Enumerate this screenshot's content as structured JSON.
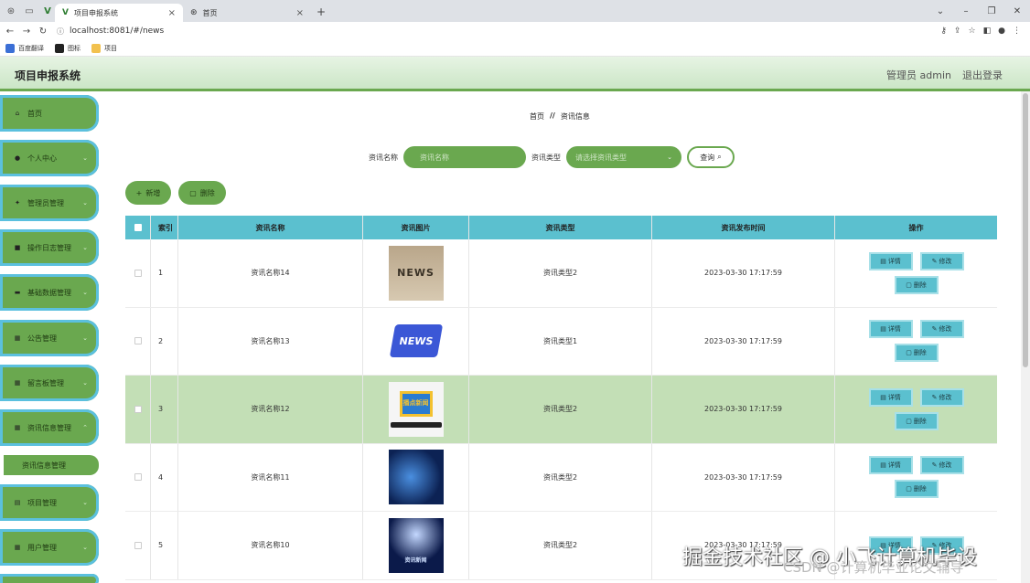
{
  "browser": {
    "tabs": [
      {
        "label": "项目申报系统",
        "active": true
      },
      {
        "label": "首页",
        "active": false
      }
    ],
    "url": "localhost:8081/#/news",
    "bookmarks": [
      "百度翻译",
      "图标",
      "项目"
    ]
  },
  "header": {
    "title": "项目申报系统",
    "user": "管理员 admin",
    "logout": "退出登录"
  },
  "sidebar": {
    "items": [
      {
        "label": "首页",
        "icon": "home-icon"
      },
      {
        "label": "个人中心",
        "icon": "user-icon"
      },
      {
        "label": "管理员管理",
        "icon": "pin-icon"
      },
      {
        "label": "操作日志管理",
        "icon": "briefcase-icon"
      },
      {
        "label": "基础数据管理",
        "icon": "chat-icon"
      },
      {
        "label": "公告管理",
        "icon": "grid-icon"
      },
      {
        "label": "留言板管理",
        "icon": "grid-icon"
      },
      {
        "label": "资讯信息管理",
        "icon": "grid-icon"
      },
      {
        "label": "项目管理",
        "icon": "table-icon"
      },
      {
        "label": "用户管理",
        "icon": "grid-icon"
      }
    ],
    "sub_item": "资讯信息管理"
  },
  "breadcrumb": {
    "home": "首页",
    "sep": "//",
    "current": "资讯信息"
  },
  "search": {
    "name_label": "资讯名称",
    "name_placeholder": "资讯名称",
    "type_label": "资讯类型",
    "type_placeholder": "请选择资讯类型",
    "query_label": "查询"
  },
  "actions": {
    "add": "新增",
    "delete": "删除"
  },
  "table": {
    "headers": [
      "索引",
      "资讯名称",
      "资讯图片",
      "资讯类型",
      "资讯发布时间",
      "操作"
    ],
    "rows": [
      {
        "index": "1",
        "name": "资讯名称14",
        "type": "资讯类型2",
        "time": "2023-03-30 17:17:59",
        "img_text": "NEWS"
      },
      {
        "index": "2",
        "name": "资讯名称13",
        "type": "资讯类型1",
        "time": "2023-03-30 17:17:59",
        "img_text": "NEWS"
      },
      {
        "index": "3",
        "name": "资讯名称12",
        "type": "资讯类型2",
        "time": "2023-03-30 17:17:59",
        "img_text": "播点新闻"
      },
      {
        "index": "4",
        "name": "资讯名称11",
        "type": "资讯类型2",
        "time": "2023-03-30 17:17:59",
        "img_text": ""
      },
      {
        "index": "5",
        "name": "资讯名称10",
        "type": "资讯类型2",
        "time": "2023-03-30 17:17:59",
        "img_text": "资讯新闻"
      }
    ],
    "op_detail": "详情",
    "op_edit": "修改",
    "op_delete": "删除"
  },
  "watermark": {
    "line1": "掘金技术社区 @ 小飞计算机毕设",
    "line2": "CSDN @计算机毕业论文辅导"
  },
  "colors": {
    "primary": "#6aa84f",
    "accent": "#5bc0cf",
    "highlight_row": "#c3dfb6"
  }
}
